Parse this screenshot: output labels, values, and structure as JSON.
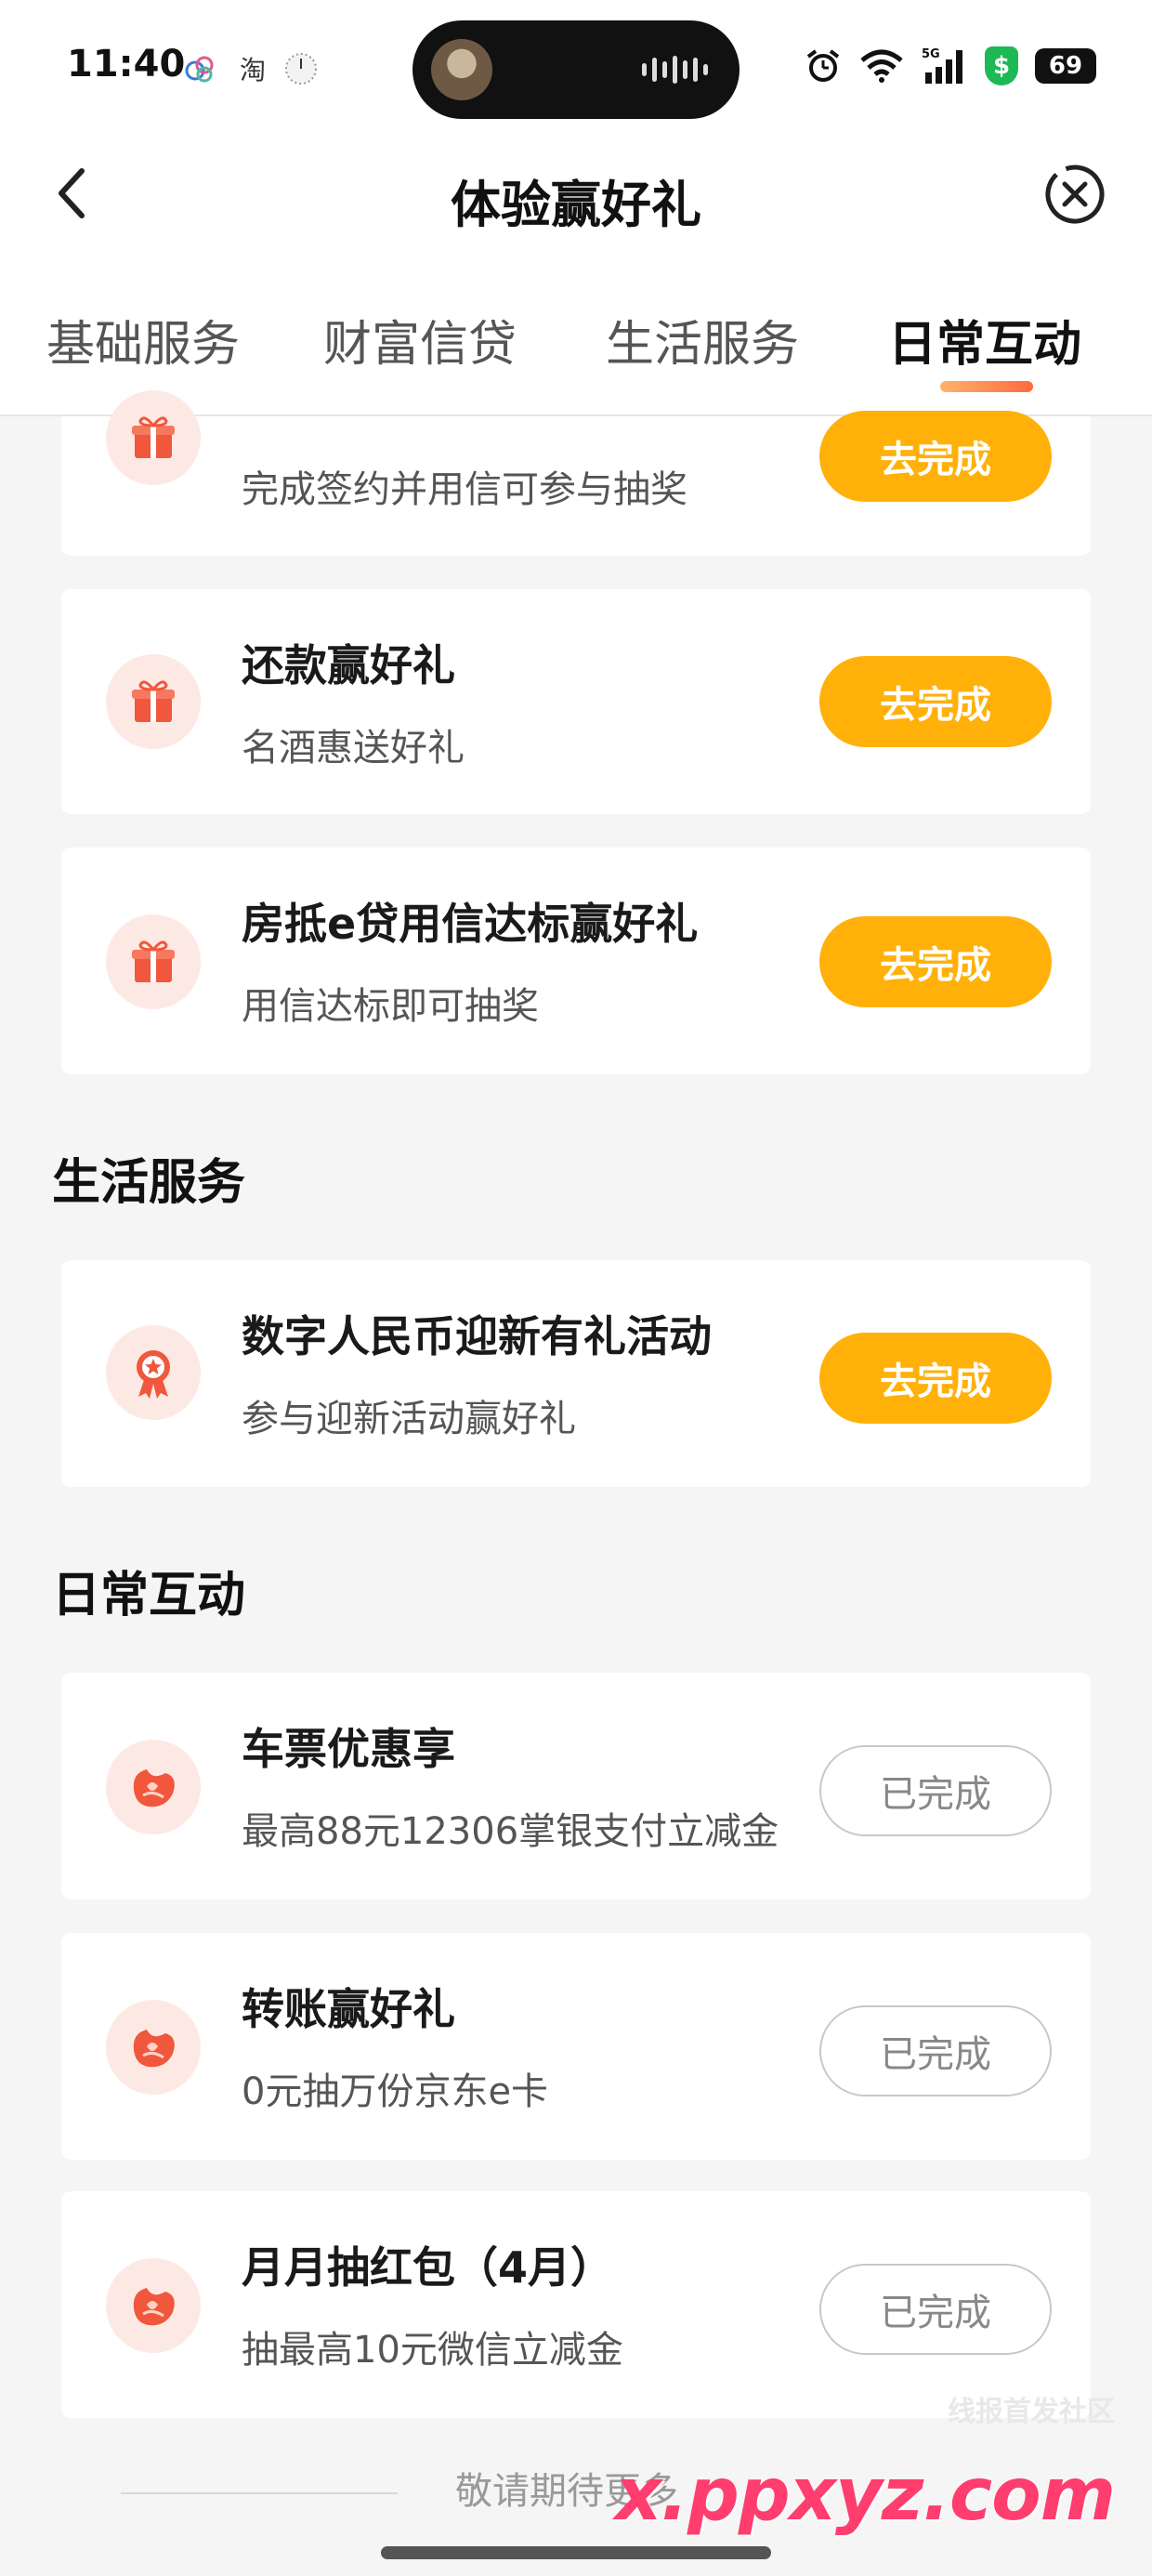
{
  "status_bar": {
    "time": "11:40",
    "taobao_label": "淘",
    "network_label": "5G",
    "shield_label": "$",
    "battery": "69",
    "icons": [
      "weather-icon",
      "taobao-icon",
      "clock-icon",
      "alarm-icon",
      "wifi-icon",
      "signal-icon",
      "shield-icon",
      "battery-icon"
    ]
  },
  "nav": {
    "title": "体验赢好礼"
  },
  "tabs": [
    {
      "label": "基础服务",
      "active": false
    },
    {
      "label": "财富信贷",
      "active": false
    },
    {
      "label": "生活服务",
      "active": false
    },
    {
      "label": "日常互动",
      "active": true
    }
  ],
  "sections": {
    "wealth_credit_cards": [
      {
        "title": "",
        "subtitle": "完成签约并用信可参与抽奖",
        "button": "去完成",
        "icon": "gift-icon"
      },
      {
        "title": "还款赢好礼",
        "subtitle": "名酒惠送好礼",
        "button": "去完成",
        "icon": "gift-icon"
      },
      {
        "title": "房抵e贷用信达标赢好礼",
        "subtitle": "用信达标即可抽奖",
        "button": "去完成",
        "icon": "gift-icon"
      }
    ],
    "life_service": {
      "title": "生活服务",
      "cards": [
        {
          "title": "数字人民币迎新有礼活动",
          "subtitle": "参与迎新活动赢好礼",
          "button": "去完成",
          "icon": "medal-icon"
        }
      ]
    },
    "daily_interaction": {
      "title": "日常互动",
      "cards": [
        {
          "title": "车票优惠享",
          "subtitle": "最高88元12306掌银支付立减金",
          "button": "已完成",
          "icon": "red-envelope-icon"
        },
        {
          "title": "转账赢好礼",
          "subtitle": "0元抽万份京东e卡",
          "button": "已完成",
          "icon": "red-envelope-icon"
        },
        {
          "title": "月月抽红包（4月）",
          "subtitle": "抽最高10元微信立减金",
          "button": "已完成",
          "icon": "red-envelope-icon"
        }
      ]
    }
  },
  "footer": {
    "text": "敬请期待更多"
  },
  "watermark": {
    "small": "线报首发社区",
    "main": "x.ppxyz.com"
  },
  "colors": {
    "accent_button": "#ffb10a",
    "tab_indicator": "#ff6a3d",
    "icon_bg": "#fde9e4",
    "icon_fg": "#f0573c"
  }
}
